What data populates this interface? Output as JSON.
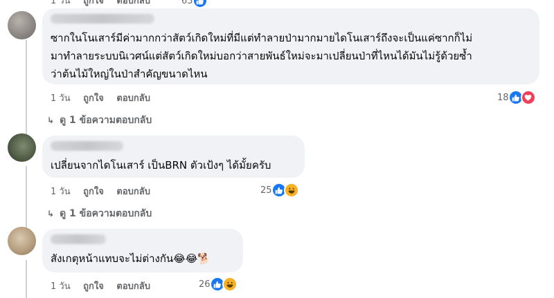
{
  "actions": {
    "time": "1 วัน",
    "like": "ถูกใจ",
    "reply": "ตอบกลับ"
  },
  "top_partial": {
    "count": "63"
  },
  "comments": [
    {
      "lines": [
        "ซากในโนเสาร์มีค่ามากกว่าสัตว์เกิดใหม่ที่มีแต่ทำลายป่ามากมายไดโนเสาร์ถึงจะเป็นแค่ซากก็ไม่",
        "มาทำลายระบบนิเวศน์แต่สัตว์เกิดใหม่บอกว่าสายพันธ์ใหม่จะมาเปลี่ยนป่าที่ไหนได้มันไม่รู้ด้วยซ้ำ",
        "ว่าต้นไม้ใหญ่ในป่าสำคัญขนาดไหน"
      ],
      "reaction_count": "18",
      "reactions": [
        "like-icon",
        "love-icon"
      ],
      "replies_label": "ดู 1 ข้อความตอบกลับ"
    },
    {
      "lines": [
        "เปลี่ยนจากไดโนเสาร์ เป็นBRN ตัวเป้งๆ ได้มั้ยครับ"
      ],
      "reaction_count": "25",
      "reactions": [
        "like-icon",
        "haha-icon"
      ],
      "replies_label": "ดู 1 ข้อความตอบกลับ"
    },
    {
      "lines": [
        "สังเกตุหน้าแทบจะไม่ต่างกัน😂😂🐕"
      ],
      "reaction_count": "26",
      "reactions": [
        "like-icon",
        "haha-icon"
      ]
    }
  ]
}
